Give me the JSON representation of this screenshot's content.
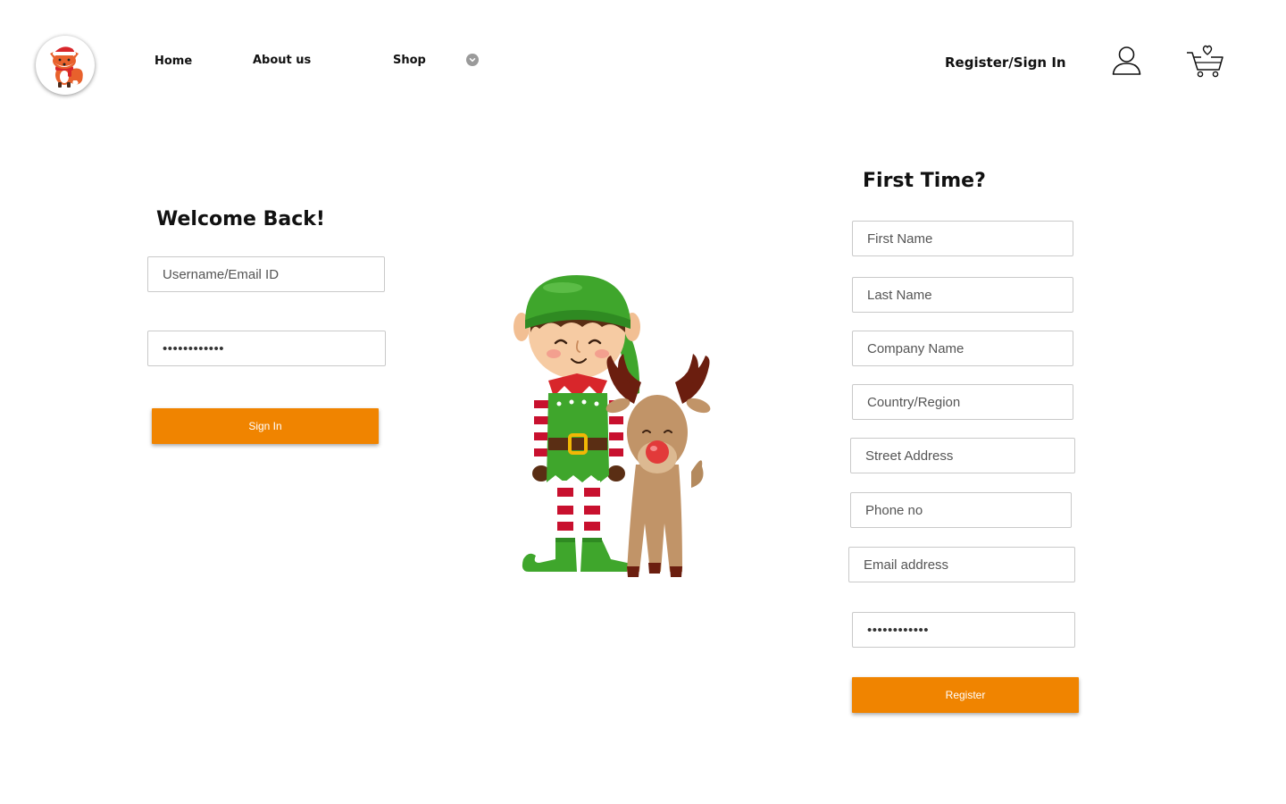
{
  "header": {
    "nav": {
      "home": "Home",
      "about": "About us",
      "shop": "Shop"
    },
    "register_signin": "Register/Sign In",
    "icons": {
      "logo": "fox-logo-icon",
      "shop_dropdown": "chevron-down-icon",
      "account": "user-icon",
      "cart": "cart-heart-icon"
    }
  },
  "login": {
    "title": "Welcome Back!",
    "username_placeholder": "Username/Email ID",
    "password_value": "password1234",
    "submit_label": "Sign In"
  },
  "register": {
    "title": "First Time?",
    "fields": {
      "first_name": "First Name",
      "last_name": "Last Name",
      "company": "Company Name",
      "country": "Country/Region",
      "street": "Street Address",
      "phone": "Phone no",
      "email": "Email address"
    },
    "password_value": "password1234",
    "submit_label": "Register"
  },
  "colors": {
    "accent": "#f08400",
    "input_border": "#c9c9c9",
    "text": "#111111"
  }
}
